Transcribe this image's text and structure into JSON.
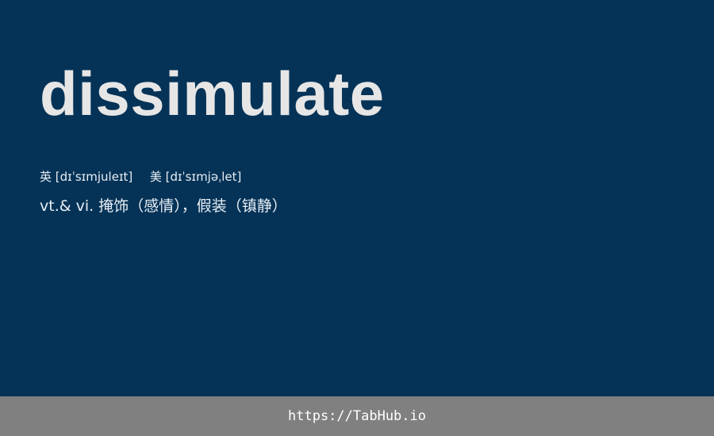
{
  "word": "dissimulate",
  "pronunciation": {
    "uk_label": "英",
    "uk_ipa": "[dɪˈsɪmjuleɪt]",
    "us_label": "美",
    "us_ipa": "[dɪˈsɪmjəˌlet]"
  },
  "definition": "vt.& vi. 掩饰（感情），假装（镇静）",
  "footer": {
    "url": "https://TabHub.io"
  },
  "colors": {
    "background": "#053357",
    "word": "#e6e6e6",
    "footer_bg": "#808080",
    "footer_text": "#ffffff"
  }
}
